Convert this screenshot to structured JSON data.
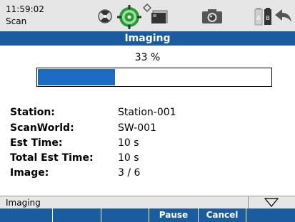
{
  "status_bar": {
    "time": "11:59:02",
    "app_name": "Scan",
    "icons": [
      "target-icon",
      "lens-icon",
      "wireless-icon",
      "memory-card-icon",
      "camera-icon",
      "battery-ab-icon",
      "back-arrow-icon"
    ]
  },
  "title": "Imaging",
  "progress": {
    "label": "33 %",
    "percent": 33
  },
  "info": [
    {
      "label": "Station:",
      "value": "Station-001"
    },
    {
      "label": "ScanWorld:",
      "value": "SW-001"
    },
    {
      "label": "Est Time:",
      "value": "10 s"
    },
    {
      "label": "Total Est Time:",
      "value": "10 s"
    },
    {
      "label": "Image:",
      "value": "3 / 6"
    }
  ],
  "bottom": {
    "status_text": "Imaging",
    "dropdown_icon": "triangle-down-icon"
  },
  "softkeys": [
    "",
    "",
    "",
    "Pause",
    "Cancel",
    ""
  ],
  "colors": {
    "accent": "#1b5c9e",
    "progress_fill": "#1d6cc1",
    "lens_green": "#2a9a3a"
  }
}
